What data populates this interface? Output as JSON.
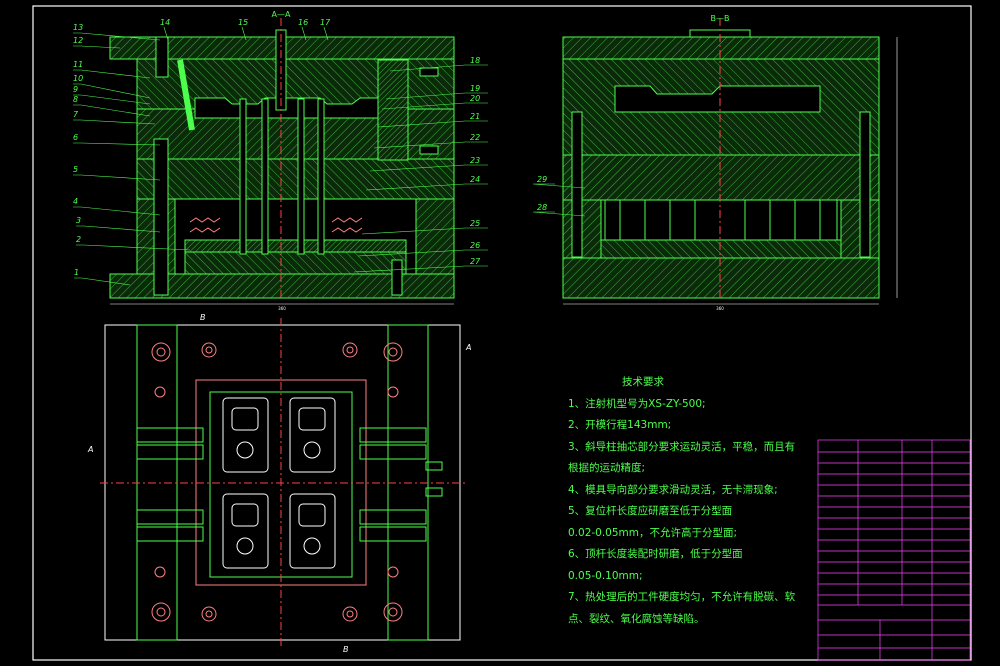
{
  "section_labels": {
    "aa": "A—A",
    "bb": "B—B"
  },
  "section_markers": {
    "b_top": "B",
    "b_bottom": "B",
    "a_left": "A",
    "a_right": "A"
  },
  "balloons_left": [
    "13",
    "12",
    "11",
    "10",
    "9",
    "8",
    "7",
    "6",
    "5",
    "4",
    "3",
    "2",
    "1"
  ],
  "balloons_top": [
    "14",
    "15",
    "16",
    "17"
  ],
  "balloons_right": [
    "18",
    "19",
    "20",
    "21",
    "22",
    "23",
    "24",
    "25",
    "26",
    "27"
  ],
  "balloons_bb": [
    "29",
    "28"
  ],
  "dimensions": {
    "width_left": "360",
    "width_right": "360"
  },
  "tech_requirements": {
    "title": "技术要求",
    "items": [
      "1、注射机型号为XS-ZY-500;",
      "2、开模行程143mm;",
      "3、斜导柱抽芯部分要求运动灵活，平稳，而且有",
      "    根据的运动精度;",
      "4、模具导向部分要求滑动灵活，无卡滞现象;",
      "5、复位杆长度应研磨至低于分型面",
      "    0.02-0.05mm，不允许高于分型面;",
      "6、顶杆长度装配时研磨，低于分型面",
      "    0.05-0.10mm;",
      "7、热处理后的工件硬度均匀，不允许有脱碳、软",
      "    点、裂纹、氧化腐蚀等缺陷。"
    ]
  },
  "colors": {
    "frame": "#ffffff",
    "part": "#4cff4c",
    "hatch": "#2f9e2f",
    "accent": "#ff4040",
    "hole": "#ff8080",
    "title_block": "#ff40ff",
    "notes": "#4cff4c"
  }
}
